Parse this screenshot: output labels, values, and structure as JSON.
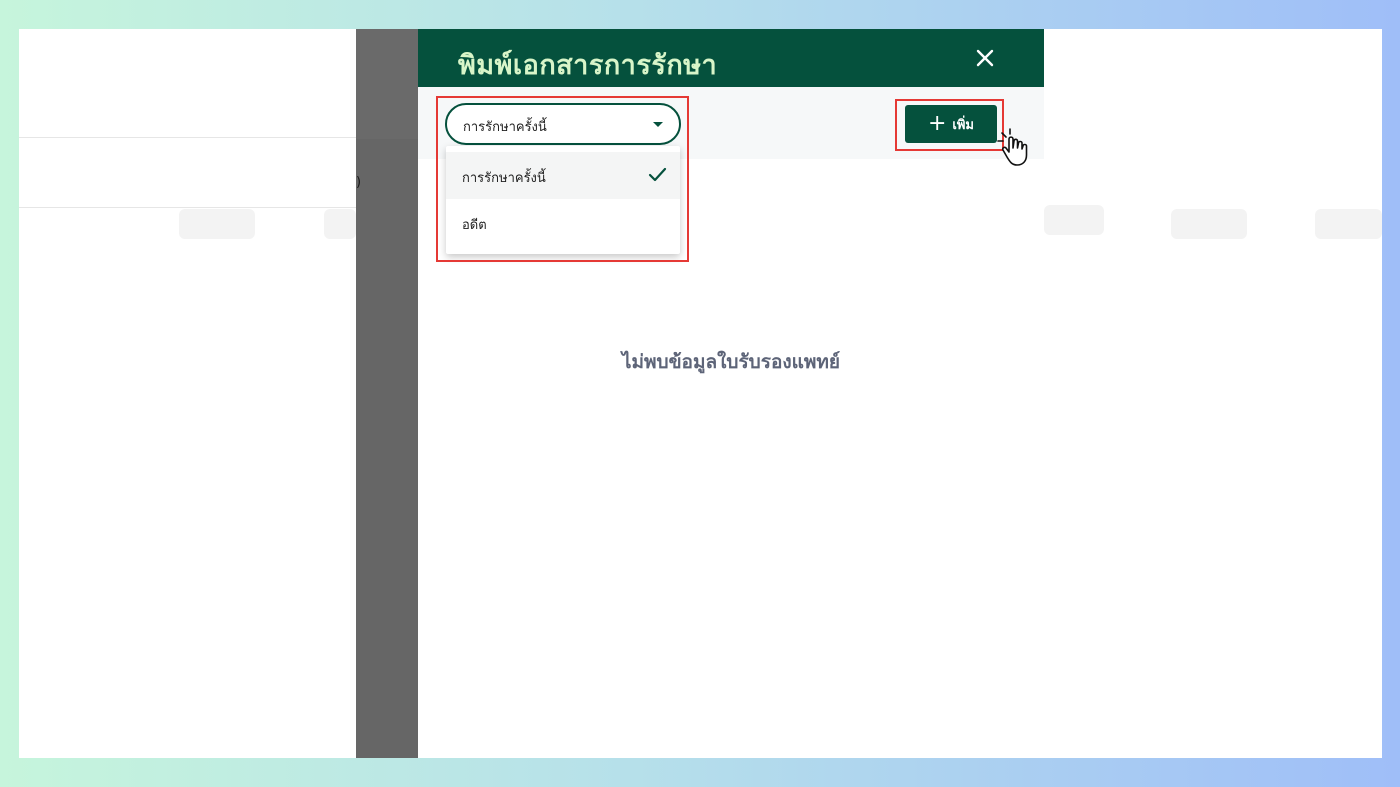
{
  "drawer": {
    "title": "พิมพ์เอกสารการรักษา",
    "close_icon": "close-icon"
  },
  "toolbar": {
    "select": {
      "value": "การรักษาครั้งนี้",
      "caret_icon": "caret-down-icon"
    },
    "add_button": {
      "icon": "plus-icon",
      "label": "เพิ่ม"
    }
  },
  "dropdown": {
    "options": [
      {
        "label": "การรักษาครั้งนี้",
        "selected": true
      },
      {
        "label": "อดีต",
        "selected": false
      }
    ],
    "check_icon": "check-icon"
  },
  "main": {
    "empty_message": "ไม่พบข้อมูลใบรับรองแพทย์"
  },
  "background": {
    "partial_text": ")"
  },
  "colors": {
    "brand_green": "#05513d",
    "title_text": "#d8f5c9",
    "highlight": "#e53935",
    "empty_text": "#5d6478"
  }
}
